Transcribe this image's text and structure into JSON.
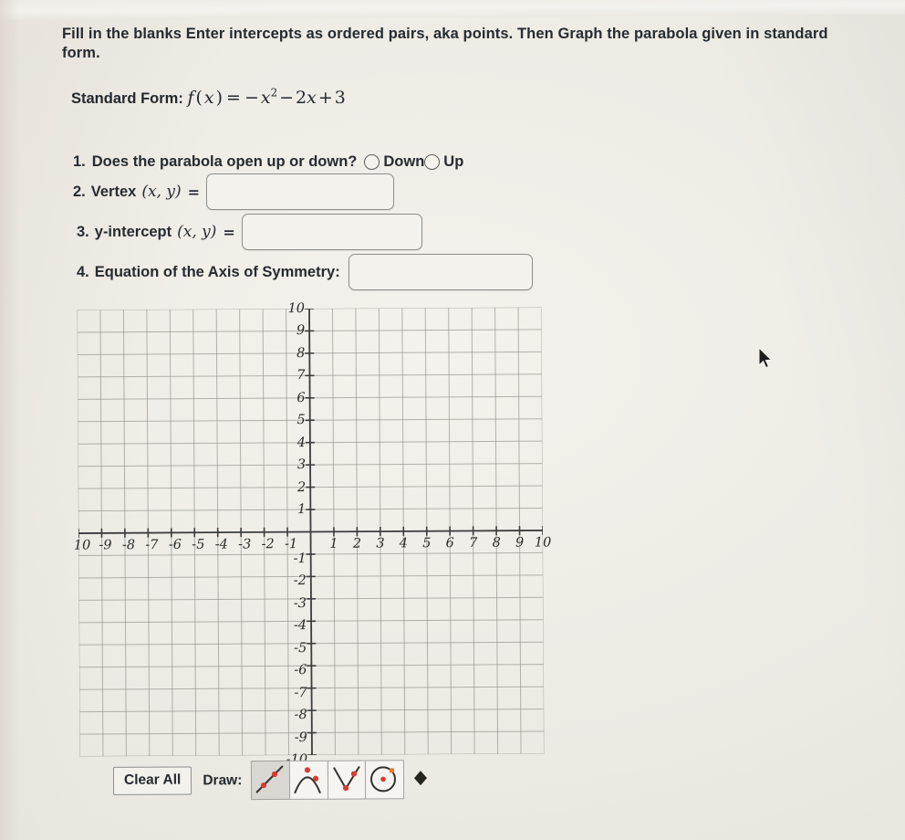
{
  "prompt": {
    "text": "Fill in the blanks Enter intercepts as ordered pairs, aka points. Then Graph the parabola given in standard form."
  },
  "standard_form": {
    "label": "Standard Form:",
    "function_name": "f",
    "variable": "x",
    "equals": "=",
    "expression": "-x^2 - 2x + 3",
    "term1_sign": "−",
    "term1": "x",
    "term1_exp": "2",
    "term2_sign": "−",
    "term2_coef": "2",
    "term2_var": "x",
    "term3_sign": "+",
    "term3": "3"
  },
  "questions": {
    "q1": {
      "number": "1.",
      "text": "Does the parabola open up or down?",
      "options": [
        {
          "label": "Down",
          "selected": false
        },
        {
          "label": "Up",
          "selected": false
        }
      ]
    },
    "q2": {
      "number": "2.",
      "label": "Vertex",
      "pair": "(x, y)",
      "equals": "=",
      "value": "",
      "placeholder": ""
    },
    "q3": {
      "number": "3.",
      "label": "y-intercept",
      "pair": "(x, y)",
      "equals": "=",
      "value": "",
      "placeholder": ""
    },
    "q4": {
      "number": "4.",
      "label": "Equation of the Axis of Symmetry:",
      "value": "",
      "placeholder": ""
    }
  },
  "graph": {
    "x_labels": [
      "10",
      "-9",
      "-8",
      "-7",
      "-6",
      "-5",
      "-4",
      "-3",
      "-2",
      "-1",
      "1",
      "2",
      "3",
      "4",
      "5",
      "6",
      "7",
      "8",
      "9",
      "10"
    ],
    "y_labels": [
      "10",
      "9",
      "8",
      "7",
      "6",
      "5",
      "4",
      "3",
      "2",
      "1",
      "-1",
      "-2",
      "-3",
      "-4",
      "-5",
      "-6",
      "-7",
      "-8",
      "-9",
      "-10"
    ],
    "x_min": -10,
    "x_max": 10,
    "y_min": -10,
    "y_max": 10,
    "step": 1,
    "grid_color": "#8a8a86",
    "axis_color": "#3c3c3c"
  },
  "toolbar": {
    "clear_all": "Clear All",
    "draw_label": "Draw:",
    "tools": [
      {
        "name": "line-tool",
        "selected": true
      },
      {
        "name": "parabola-tool",
        "selected": false
      },
      {
        "name": "absolute-value-tool",
        "selected": false
      },
      {
        "name": "circle-tool",
        "selected": false
      },
      {
        "name": "point-tool",
        "selected": false
      }
    ],
    "point_color": "#d93b32",
    "handle_color": "#e8762c"
  }
}
